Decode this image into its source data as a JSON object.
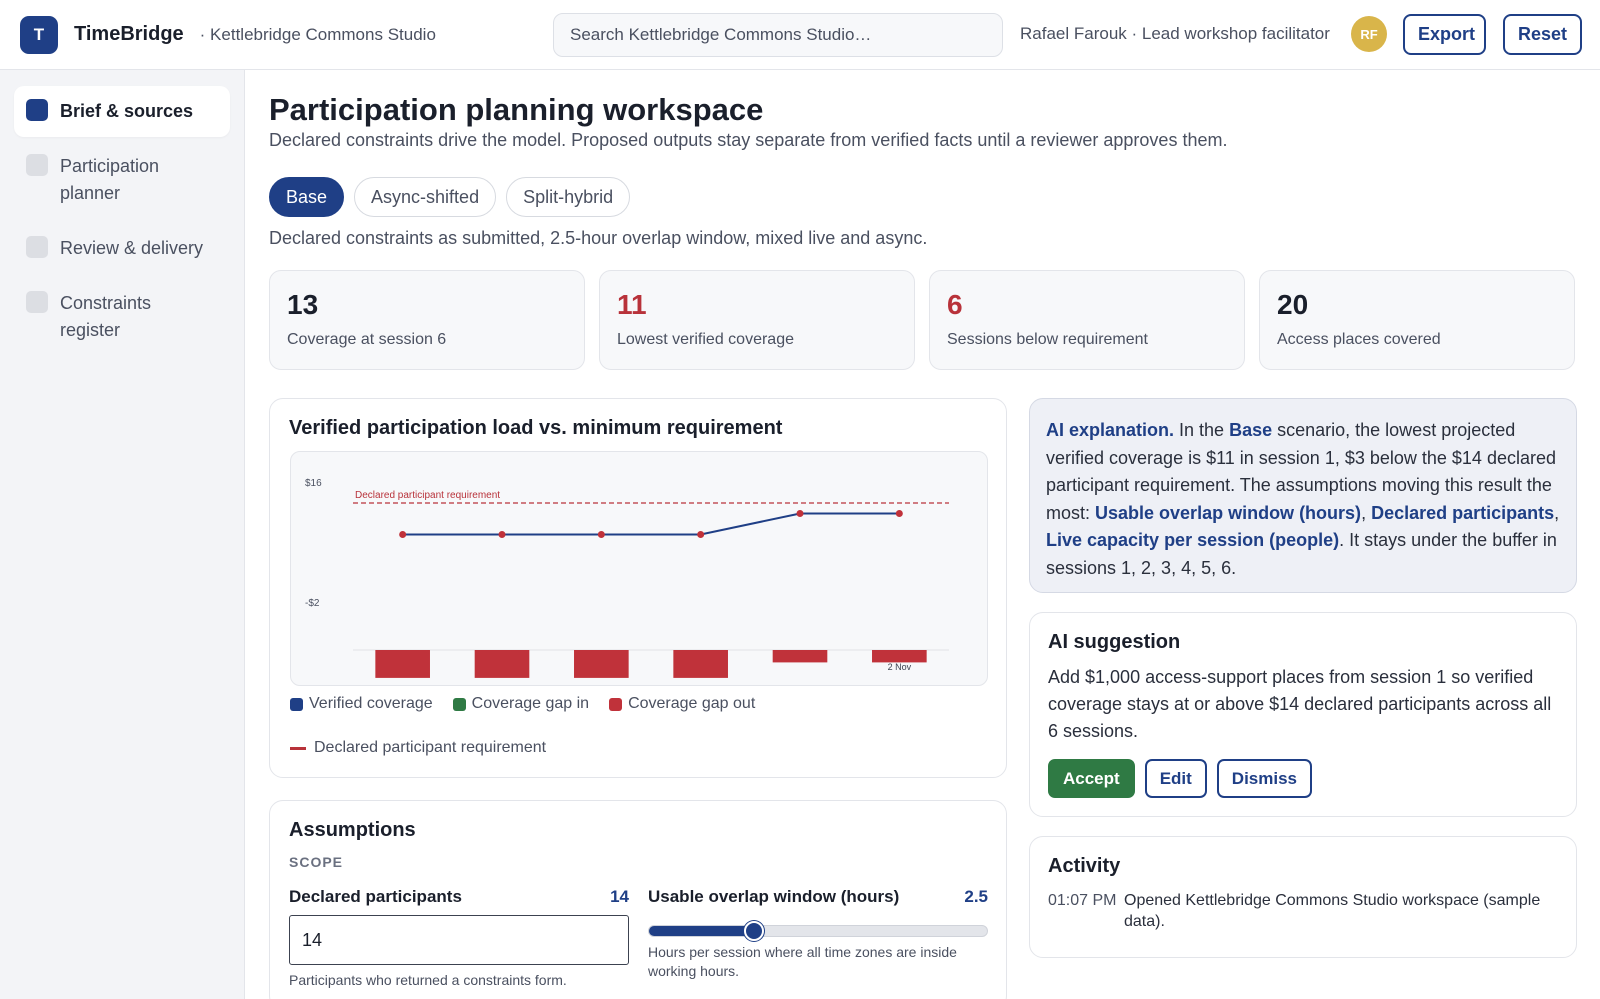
{
  "header": {
    "logo_letter": "T",
    "app_name": "TimeBridge",
    "workspace": "· Kettlebridge Commons Studio",
    "search_placeholder": "Search Kettlebridge Commons Studio…",
    "user": "Rafael Farouk · Lead workshop facilitator",
    "avatar_initials": "RF",
    "export_label": "Export",
    "reset_label": "Reset"
  },
  "sidebar": {
    "items": [
      {
        "label": "Brief & sources",
        "active": true
      },
      {
        "label": "Participation planner",
        "active": false
      },
      {
        "label": "Review & delivery",
        "active": false
      },
      {
        "label": "Constraints register",
        "active": false
      }
    ]
  },
  "page": {
    "title": "Participation planning workspace",
    "subtitle": "Declared constraints drive the model. Proposed outputs stay separate from verified facts until a reviewer approves them.",
    "tabs": [
      {
        "label": "Base",
        "active": true
      },
      {
        "label": "Async-shifted",
        "active": false
      },
      {
        "label": "Split-hybrid",
        "active": false
      }
    ],
    "scenario_description": "Declared constraints as submitted, 2.5-hour overlap window, mixed live and async."
  },
  "kpis": [
    {
      "value": "13",
      "label": "Coverage at session 6",
      "danger": false
    },
    {
      "value": "11",
      "label": "Lowest verified coverage",
      "danger": true
    },
    {
      "value": "6",
      "label": "Sessions below requirement",
      "danger": true
    },
    {
      "value": "20",
      "label": "Access places covered",
      "danger": false
    }
  ],
  "chart_card": {
    "title": "Verified participation load vs. minimum requirement"
  },
  "chart_data": {
    "type": "bar",
    "title": "Verified participation load vs. minimum requirement",
    "x": [
      1,
      2,
      3,
      4,
      5,
      6
    ],
    "x_tick_labels": [
      "",
      "",
      "",
      "",
      "",
      "2 Nov"
    ],
    "y_tick_labels": [
      "$16",
      "-$2"
    ],
    "ylim": [
      -10,
      16
    ],
    "series": [
      {
        "name": "Verified coverage",
        "type": "line",
        "color": "#1f3f86",
        "values": [
          11,
          11,
          11,
          11,
          13,
          13
        ]
      },
      {
        "name": "Coverage gap in",
        "type": "bar",
        "color": "#2f7a44",
        "values": [
          0,
          0,
          0,
          0,
          0,
          0
        ]
      },
      {
        "name": "Coverage gap out",
        "type": "bar",
        "color": "#c0323a",
        "values": [
          -9,
          -9,
          -9,
          -9,
          -4,
          -4
        ]
      }
    ],
    "reference_line": {
      "name": "Declared participant requirement",
      "value": 14,
      "color": "#b8323a"
    },
    "annotation": "Declared participant requirement",
    "legend_position": "bottom-left",
    "grid": false
  },
  "assumptions": {
    "title": "Assumptions",
    "section": "SCOPE",
    "declared_participants": {
      "label": "Declared participants",
      "value": "14",
      "input_value": "14",
      "help": "Participants who returned a constraints form."
    },
    "overlap_window": {
      "label": "Usable overlap window (hours)",
      "value": "2.5",
      "fraction": 0.31,
      "help": "Hours per session where all time zones are inside working hours."
    }
  },
  "explanation": {
    "lead": "AI explanation.",
    "t1": " In the ",
    "scenario": "Base",
    "t2": " scenario, the lowest projected verified coverage is $11 in session 1, $3 below the $14 declared participant requirement. The assumptions moving this result the most: ",
    "f1": "Usable overlap window (hours)",
    "sep1": ", ",
    "f2": "Declared participants",
    "sep2": ", ",
    "f3": "Live capacity per session (people)",
    "t3": ". It stays under the buffer in sessions 1, 2, 3, 4, 5, 6."
  },
  "suggestion": {
    "title": "AI suggestion",
    "text": "Add $1,000 access-support places from session 1 so verified coverage stays at or above $14 declared participants across all 6 sessions.",
    "accept": "Accept",
    "edit": "Edit",
    "dismiss": "Dismiss"
  },
  "activity": {
    "title": "Activity",
    "entries": [
      {
        "time": "01:07 PM",
        "text": "Opened Kettlebridge Commons Studio workspace (sample data)."
      }
    ]
  }
}
